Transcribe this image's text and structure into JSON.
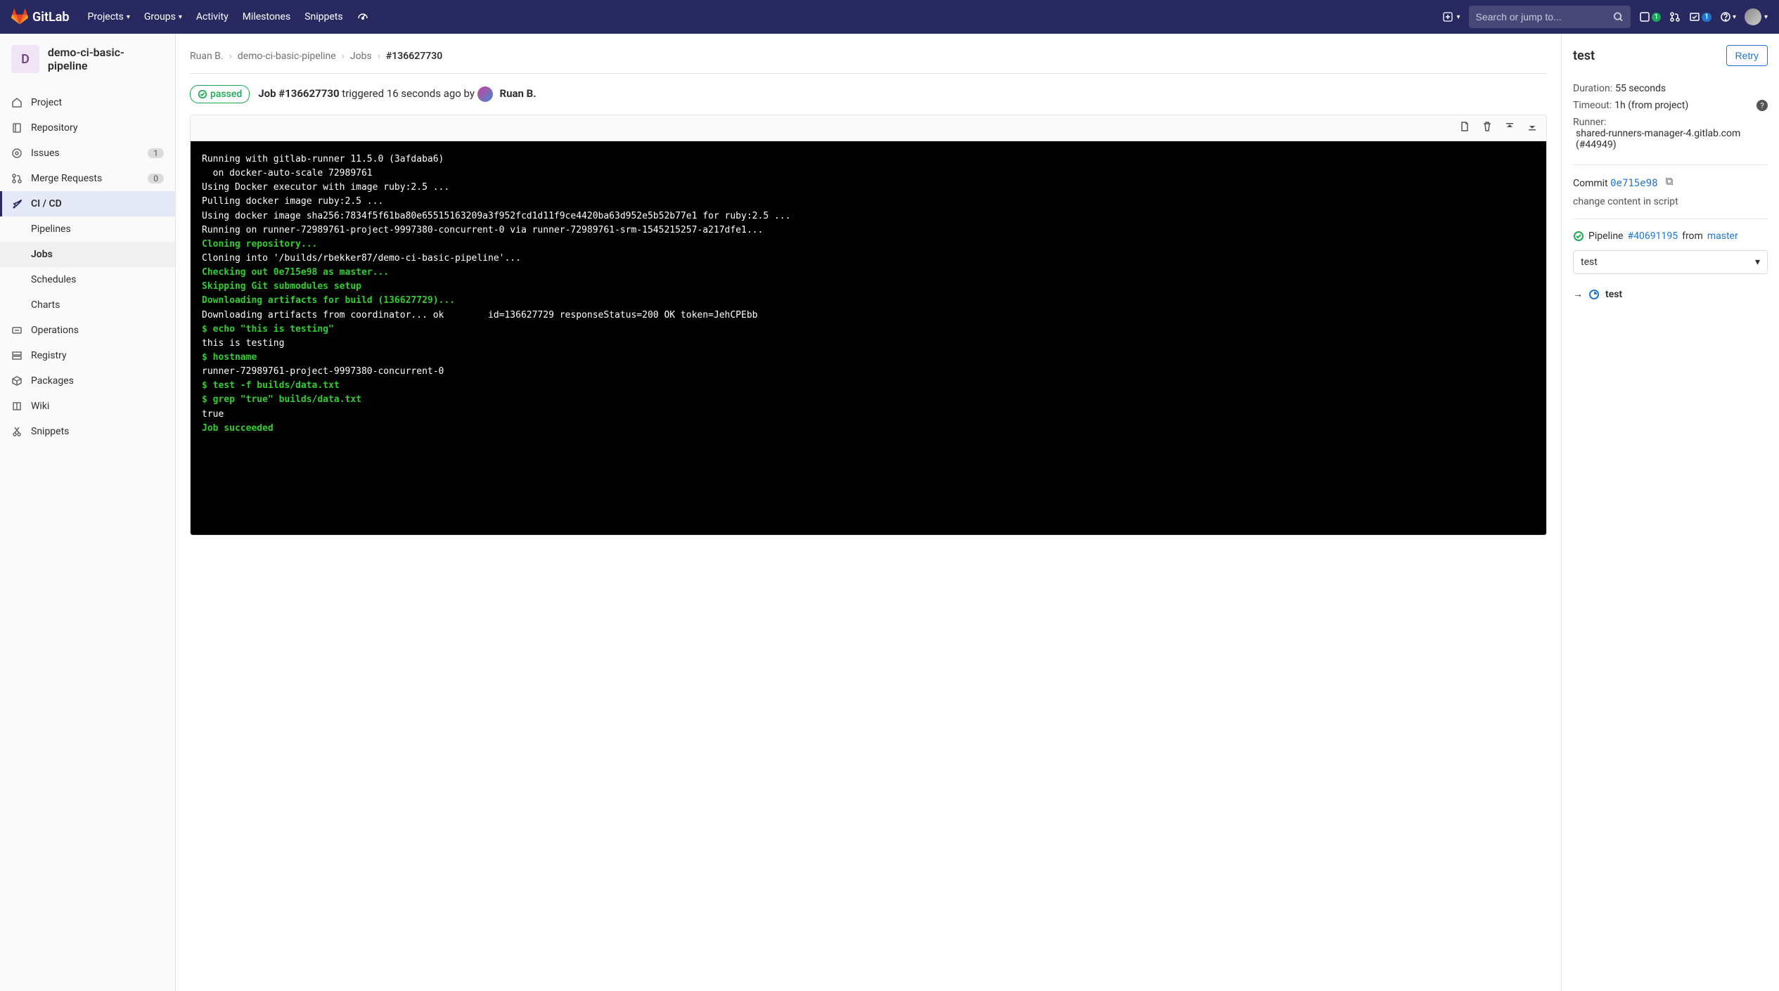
{
  "brand": "GitLab",
  "nav": {
    "projects": "Projects",
    "groups": "Groups",
    "activity": "Activity",
    "milestones": "Milestones",
    "snippets": "Snippets"
  },
  "search_placeholder": "Search or jump to...",
  "nav_badges": {
    "issues": "1",
    "todos": "1"
  },
  "project": {
    "avatar_letter": "D",
    "name": "demo-ci-basic-pipeline"
  },
  "sidebar": {
    "project": "Project",
    "repository": "Repository",
    "issues": "Issues",
    "issues_count": "1",
    "merge_requests": "Merge Requests",
    "mr_count": "0",
    "cicd": "CI / CD",
    "cicd_sub": {
      "pipelines": "Pipelines",
      "jobs": "Jobs",
      "schedules": "Schedules",
      "charts": "Charts"
    },
    "operations": "Operations",
    "registry": "Registry",
    "packages": "Packages",
    "wiki": "Wiki",
    "snippets": "Snippets"
  },
  "breadcrumbs": {
    "owner": "Ruan B.",
    "project": "demo-ci-basic-pipeline",
    "jobs": "Jobs",
    "current": "#136627730"
  },
  "job": {
    "status": "passed",
    "title_prefix": "Job #136627730",
    "triggered": " triggered 16 seconds ago by ",
    "author": "Ruan B."
  },
  "log": [
    {
      "c": "",
      "t": "Running with gitlab-runner 11.5.0 (3afdaba6)"
    },
    {
      "c": "",
      "t": "  on docker-auto-scale 72989761"
    },
    {
      "c": "",
      "t": "Using Docker executor with image ruby:2.5 ..."
    },
    {
      "c": "",
      "t": "Pulling docker image ruby:2.5 ..."
    },
    {
      "c": "",
      "t": "Using docker image sha256:7834f5f61ba80e65515163209a3f952fcd1d11f9ce4420ba63d952e5b52b77e1 for ruby:2.5 ..."
    },
    {
      "c": "",
      "t": "Running on runner-72989761-project-9997380-concurrent-0 via runner-72989761-srm-1545215257-a217dfe1..."
    },
    {
      "c": "greenb",
      "t": "Cloning repository..."
    },
    {
      "c": "",
      "t": "Cloning into '/builds/rbekker87/demo-ci-basic-pipeline'..."
    },
    {
      "c": "greenb",
      "t": "Checking out 0e715e98 as master..."
    },
    {
      "c": "greenb",
      "t": "Skipping Git submodules setup"
    },
    {
      "c": "greenb",
      "t": "Downloading artifacts for build (136627729)..."
    },
    {
      "c": "",
      "t": "Downloading artifacts from coordinator... ok        id=136627729 responseStatus=200 OK token=JehCPEbb"
    },
    {
      "c": "greenb",
      "t": "$ echo \"this is testing\""
    },
    {
      "c": "",
      "t": "this is testing"
    },
    {
      "c": "greenb",
      "t": "$ hostname"
    },
    {
      "c": "",
      "t": "runner-72989761-project-9997380-concurrent-0"
    },
    {
      "c": "greenb",
      "t": "$ test -f builds/data.txt"
    },
    {
      "c": "greenb",
      "t": "$ grep \"true\" builds/data.txt"
    },
    {
      "c": "",
      "t": "true"
    },
    {
      "c": "greenb",
      "t": "Job succeeded"
    }
  ],
  "panel": {
    "title": "test",
    "retry": "Retry",
    "duration_label": "Duration:",
    "duration_value": "55 seconds",
    "timeout_label": "Timeout:",
    "timeout_value": "1h (from project)",
    "runner_label": "Runner:",
    "runner_value": "shared-runners-manager-4.gitlab.com (#44949)",
    "commit_label": "Commit",
    "commit_sha": "0e715e98",
    "commit_msg": "change content in script",
    "pipeline_label": "Pipeline",
    "pipeline_id": "#40691195",
    "pipeline_from": "from",
    "pipeline_branch": "master",
    "stage_select": "test",
    "stage_job": "test"
  }
}
